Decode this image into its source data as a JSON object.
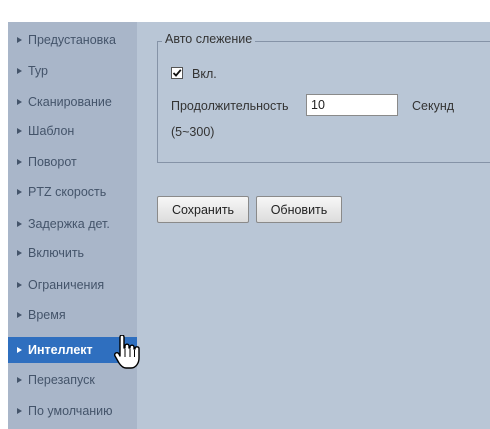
{
  "sidebar": {
    "items": [
      {
        "label": "Предустановка"
      },
      {
        "label": "Тур"
      },
      {
        "label": "Сканирование"
      },
      {
        "label": "Шаблон"
      },
      {
        "label": "Поворот"
      },
      {
        "label": "PTZ скорость"
      },
      {
        "label": "Задержка дет."
      },
      {
        "label": "Включить"
      },
      {
        "label": "Ограничения"
      },
      {
        "label": "Время"
      },
      {
        "label": "Интеллект",
        "active": true
      },
      {
        "label": "Перезапуск"
      },
      {
        "label": "По умолчанию"
      }
    ]
  },
  "panel": {
    "legend": "Авто слежение",
    "enable": {
      "label": "Вкл.",
      "checked": true
    },
    "duration": {
      "label": "Продолжительность",
      "value": "10",
      "unit": "Секунд",
      "range": "(5~300)"
    }
  },
  "buttons": {
    "save": "Сохранить",
    "refresh": "Обновить"
  },
  "colors": {
    "sidebar_bg": "#a9b6c9",
    "main_bg": "#b9c6d6",
    "active_item": "#2f6fbf"
  },
  "icons": {
    "cursor": "hand-pointer-icon",
    "arrow": "triangle-right-icon",
    "check": "checkmark-icon"
  }
}
